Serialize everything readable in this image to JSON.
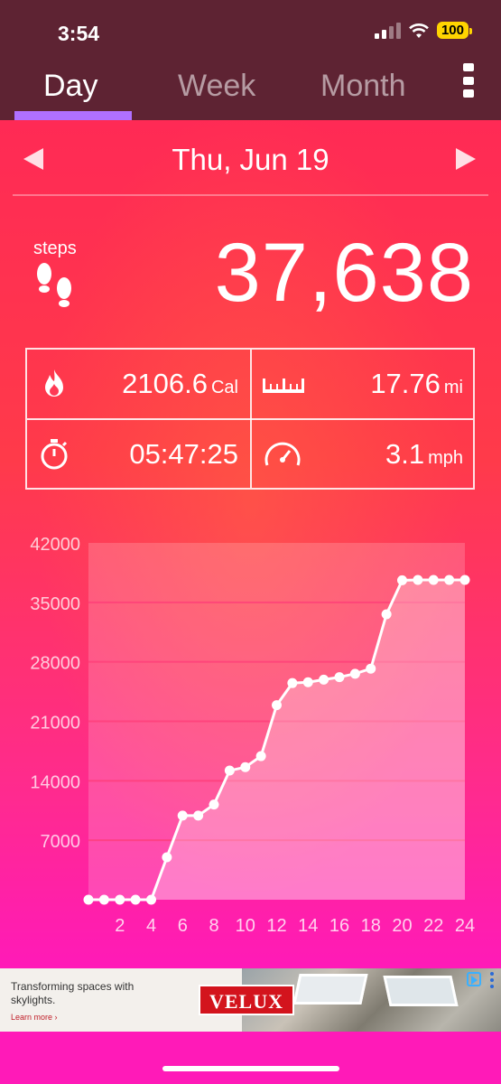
{
  "status_bar": {
    "time": "3:54",
    "battery": "100"
  },
  "tabs": [
    {
      "label": "Day",
      "active": true
    },
    {
      "label": "Week",
      "active": false
    },
    {
      "label": "Month",
      "active": false
    }
  ],
  "date": {
    "label": "Thu, Jun 19"
  },
  "steps": {
    "label": "steps",
    "value": "37,638"
  },
  "stats": {
    "calories": {
      "value": "2106.6",
      "unit": "Cal",
      "icon": "flame-icon"
    },
    "distance": {
      "value": "17.76",
      "unit": "mi",
      "icon": "ruler-icon"
    },
    "duration": {
      "value": "05:47:25",
      "icon": "stopwatch-icon"
    },
    "speed": {
      "value": "3.1",
      "unit": "mph",
      "icon": "speedometer-icon"
    }
  },
  "chart_data": {
    "type": "area",
    "x": [
      0,
      1,
      2,
      3,
      4,
      5,
      6,
      7,
      8,
      9,
      10,
      11,
      12,
      13,
      14,
      15,
      16,
      17,
      18,
      19,
      20,
      21,
      22,
      23,
      24
    ],
    "values": [
      0,
      0,
      0,
      0,
      0,
      5000,
      9900,
      9900,
      11200,
      15200,
      15600,
      16900,
      22900,
      25500,
      25600,
      25900,
      26200,
      26600,
      27200,
      33600,
      37600,
      37638,
      37638,
      37638,
      37638
    ],
    "xticks": [
      "2",
      "4",
      "6",
      "8",
      "10",
      "12",
      "14",
      "16",
      "18",
      "20",
      "22",
      "24"
    ],
    "yticks": [
      "42000",
      "35000",
      "28000",
      "21000",
      "14000",
      "7000"
    ],
    "ylim": [
      0,
      42000
    ],
    "xlim": [
      0,
      24
    ],
    "grid": true
  },
  "ad": {
    "headline": "Transforming spaces with skylights.",
    "cta": "Learn more ›",
    "brand": "VELUX"
  },
  "colors": {
    "tab_underline": "#b070ff",
    "header_bg": "#5e2333"
  }
}
